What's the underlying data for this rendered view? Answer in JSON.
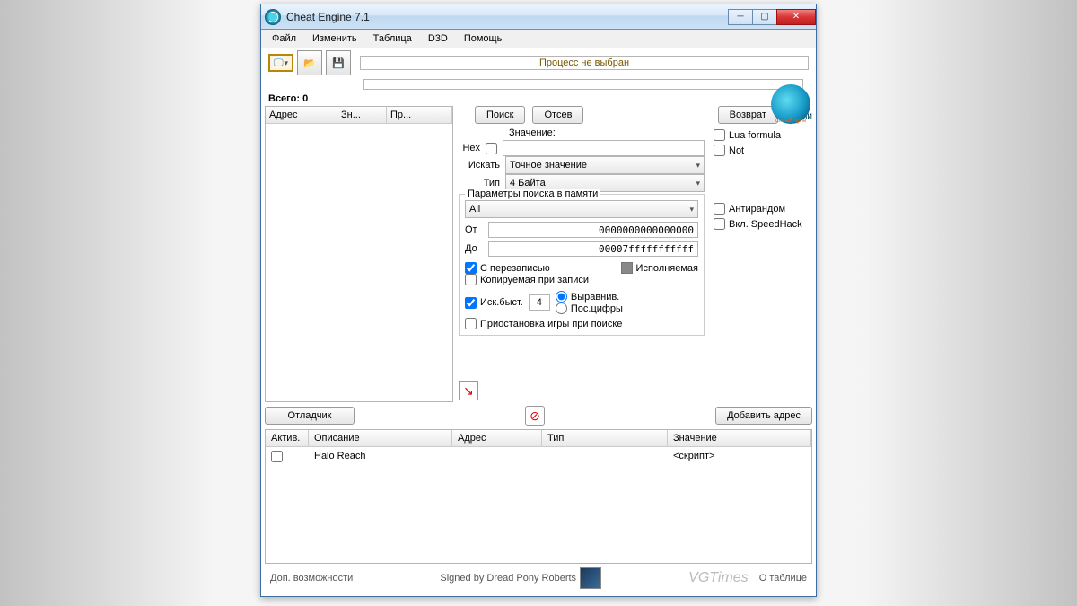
{
  "title": "Cheat Engine 7.1",
  "menu": {
    "file": "Файл",
    "edit": "Изменить",
    "table": "Таблица",
    "d3d": "D3D",
    "help": "Помощь"
  },
  "process_bar": "Процесс не выбран",
  "total_label": "Всего:",
  "total_value": "0",
  "left_cols": {
    "addr": "Адрес",
    "val": "Зн...",
    "prev": "Пр..."
  },
  "buttons": {
    "search": "Поиск",
    "filter": "Отсев",
    "undo": "Возврат",
    "options": "Опции",
    "debugger": "Отладчик",
    "add_addr": "Добавить адрес"
  },
  "labels": {
    "value": "Значение:",
    "hex": "Hex",
    "scan": "Искать",
    "type": "Тип",
    "mem_params": "Параметры поиска в памяти",
    "from": "От",
    "to": "До"
  },
  "dropdowns": {
    "scan": "Точное значение",
    "type": "4 Байта",
    "region": "All"
  },
  "mem": {
    "from": "0000000000000000",
    "to": "00007fffffffffff"
  },
  "checks": {
    "lua": "Lua formula",
    "not": "Not",
    "antirandom": "Антирандом",
    "speedhack": "Вкл. SpeedHack",
    "overwrite": "С перезаписью",
    "executable": "Исполняемая",
    "copy_on_write": "Копируемая при записи",
    "fast": "Иск.быст.",
    "align": "Выравнив.",
    "digits": "Пос.цифры",
    "pause": "Приостановка игры при поиске"
  },
  "fast_value": "4",
  "tbl_cols": {
    "active": "Актив.",
    "desc": "Описание",
    "addr": "Адрес",
    "type": "Тип",
    "value": "Значение"
  },
  "rows": [
    {
      "desc": "Halo Reach",
      "addr": "",
      "type": "",
      "value": "<скрипт>"
    }
  ],
  "footer": {
    "extra": "Доп. возможности",
    "signed": "Signed by Dread Pony Roberts",
    "about": "О таблице"
  },
  "watermark": "VGTimes"
}
